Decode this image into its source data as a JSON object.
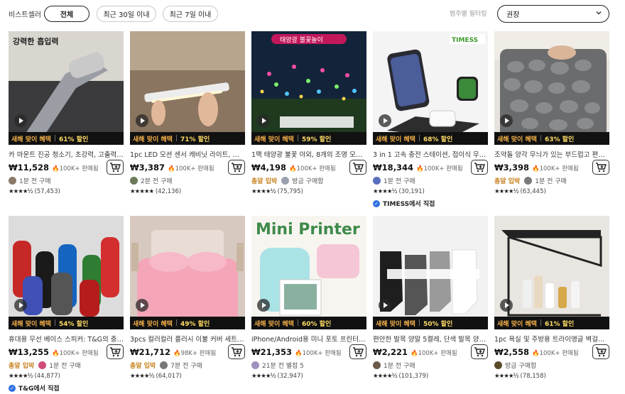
{
  "toolbar": {
    "section_label": "비스트셀러",
    "filter_chips": [
      {
        "label": "전체",
        "active": true
      },
      {
        "label": "최근 30일 이내",
        "active": false
      },
      {
        "label": "최근 7일 이내",
        "active": false
      }
    ],
    "category_filter_label": "범주별 필터링",
    "sort_select_value": "권장"
  },
  "colors": {
    "deal_bar": "#111111",
    "deal_tag": "#f5b04a",
    "flame": "#f07d1a",
    "fast_ship": "#c7801b",
    "verified": "#2f6fe0"
  },
  "products": [
    {
      "title": "카 마운트 진공 청소기, 초강력, 고출력 ...",
      "price": "₩11,528",
      "sold": "100K+ 판매됨",
      "deal_tag": "새해 맞이 혜택",
      "discount": "61% 할인",
      "fast_ship": "",
      "seller_meta": "1분 전 구매",
      "stars": "★★★★½",
      "reviews": "(57,453)",
      "direct": "",
      "image_text": "강력한 흡입력",
      "icon": "vacuum-image"
    },
    {
      "title": "1pc LED 모션 센서 캐비닛 라이트, 언더 ...",
      "price": "₩3,387",
      "sold": "100K+ 판매됨",
      "deal_tag": "새해 맞이 혜택",
      "discount": "71% 할인",
      "fast_ship": "",
      "seller_meta": "2분 전 구매",
      "stars": "★★★★★",
      "reviews": "(42,136)",
      "direct": "",
      "image_text": "",
      "icon": "led-light-image"
    },
    {
      "title": "1팩 태양광 불꽃 야외, 8개의 조명 모드 ...",
      "price": "₩4,198",
      "sold": "100K+ 판매됨",
      "deal_tag": "새해 맞이 혜택",
      "discount": "59% 할인",
      "fast_ship": "총알 입박",
      "seller_meta": "방금 구매함",
      "stars": "★★★★½",
      "reviews": "(75,795)",
      "direct": "",
      "image_text": "태양광 불꽃놀이",
      "icon": "solar-firework-image"
    },
    {
      "title": "3 in 1 고속 충전 스테이션, 접이식 무선 ...",
      "price": "₩18,344",
      "sold": "100K+ 판매됨",
      "deal_tag": "새해 맞이 혜택",
      "discount": "68% 할인",
      "fast_ship": "",
      "seller_meta": "1분 전 구매",
      "stars": "★★★★½",
      "reviews": "(30,191)",
      "direct": "TIMESS에서 직접",
      "image_text": "TIMESS",
      "icon": "charger-image"
    },
    {
      "title": "조약돌 양각 무늬가 있는 부드럽고 편안 ...",
      "price": "₩3,398",
      "sold": "100K+ 판매됨",
      "deal_tag": "새해 맞이 혜택",
      "discount": "63% 할인",
      "fast_ship": "총알 입박",
      "seller_meta": "1분 전 구매",
      "stars": "★★★★½",
      "reviews": "(63,445)",
      "direct": "",
      "image_text": "",
      "icon": "bath-mat-image"
    },
    {
      "title": "휴대용 무선 베이스 스피커: T&G의 충전 ...",
      "price": "₩13,255",
      "sold": "100K+ 판매됨",
      "deal_tag": "새해 맞이 혜택",
      "discount": "54% 할인",
      "fast_ship": "총알 입박",
      "seller_meta": "1분 전 구매",
      "stars": "★★★★½",
      "reviews": "(44,877)",
      "direct": "T&G에서 직접",
      "image_text": "",
      "icon": "speaker-image"
    },
    {
      "title": "3pcs 컬러컬러 플러시 이불 커버 세트 - ...",
      "price": "₩21,712",
      "sold": "98K+ 판매됨",
      "deal_tag": "새해 맞이 혜택",
      "discount": "49% 할인",
      "fast_ship": "총알 입박",
      "seller_meta": "7분 전 구매",
      "stars": "★★★★½",
      "reviews": "(64,017)",
      "direct": "",
      "image_text": "",
      "icon": "bedding-image"
    },
    {
      "title": "iPhone/Android용 미니 포토 프린터, ...",
      "price": "₩21,353",
      "sold": "100K+ 판매됨",
      "deal_tag": "새해 맞이 혜택",
      "discount": "60% 할인",
      "fast_ship": "",
      "seller_meta": "21분 전 별점 5",
      "stars": "★★★★½",
      "reviews": "(32,947)",
      "direct": "",
      "image_text": "Mini Printer",
      "icon": "mini-printer-image"
    },
    {
      "title": "편안한 발목 양말 5켤레, 단색 발목 양말...",
      "price": "₩2,221",
      "sold": "100K+ 판매됨",
      "deal_tag": "새해 맞이 혜택",
      "discount": "50% 할인",
      "fast_ship": "",
      "seller_meta": "1분 전 구매",
      "stars": "★★★★½",
      "reviews": "(101,379)",
      "direct": "",
      "image_text": "",
      "icon": "socks-image"
    },
    {
      "title": "1pc 욕실 및 주방용 트라이앵글 벽걸이 ...",
      "price": "₩2,558",
      "sold": "100K+ 판매됨",
      "deal_tag": "새해 맞이 혜택",
      "discount": "61% 할인",
      "fast_ship": "",
      "seller_meta": "방금 구매함",
      "stars": "★★★★½",
      "reviews": "(78,158)",
      "direct": "",
      "image_text": "",
      "icon": "shelf-image"
    }
  ]
}
